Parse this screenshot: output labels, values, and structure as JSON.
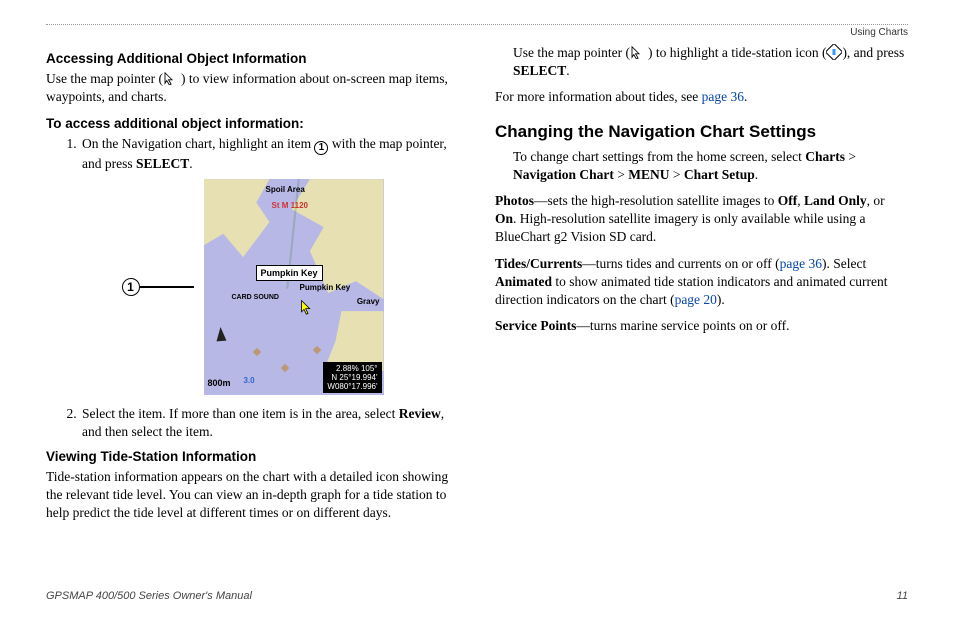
{
  "header": {
    "section": "Using Charts"
  },
  "left": {
    "h1": "Accessing Additional Object Information",
    "p1a": "Use the map pointer (",
    "p1b": ") to view information about on-screen map items, waypoints, and charts.",
    "h2": "To access additional object information:",
    "li1a": "On the Navigation chart, highlight an item ",
    "li1b": " with the map pointer, and press ",
    "li1c": "SELECT",
    "li1d": ".",
    "callout_num": "1",
    "map": {
      "spoil": "Spoil Area",
      "stm": "St M 1120",
      "pk_box": "Pumpkin Key",
      "pk_lbl": "Pumpkin Key",
      "card": "CARD SOUND",
      "gravy": "Gravy",
      "day": "3.0",
      "scale": "800m",
      "f1": "2.88%   105°",
      "f2": "N  25°19.994'",
      "f3": "W080°17.996'"
    },
    "li2a": "Select the item. If more than one item is in the area, select ",
    "li2b": "Review",
    "li2c": ", and then select the item.",
    "h3": "Viewing Tide-Station Information",
    "p3": "Tide-station information appears on the chart with a detailed icon showing the relevant tide level. You can view an in-depth graph for a tide station to help predict the tide level at different times or on different days."
  },
  "right": {
    "p1a": "Use the map pointer (",
    "p1b": ") to highlight a tide-station icon (",
    "p1c": "), and press ",
    "p1d": "SELECT",
    "p1e": ".",
    "p2a": "For more information about tides, see ",
    "p2b": "page 36",
    "p2c": ".",
    "h1": "Changing the Navigation Chart Settings",
    "p3a": "To change chart settings from the home screen, select ",
    "p3b": "Charts",
    "p3c": " > ",
    "p3d": "Navigation Chart",
    "p3e": " > ",
    "p3f": "MENU",
    "p3g": " > ",
    "p3h": "Chart Setup",
    "p3i": ".",
    "p4a": "Photos",
    "p4b": "—sets the high-resolution satellite images to ",
    "p4c": "Off",
    "p4d": ", ",
    "p4e": "Land Only",
    "p4f": ", or ",
    "p4g": "On",
    "p4h": ". High-resolution satellite imagery is only available while using a BlueChart g2 Vision SD card.",
    "p5a": "Tides/Currents",
    "p5b": "—turns tides and currents on or off (",
    "p5c": "page 36",
    "p5d": "). Select ",
    "p5e": "Animated",
    "p5f": " to show animated tide station indicators and animated current direction indicators on the chart (",
    "p5g": "page 20",
    "p5h": ").",
    "p6a": "Service Points",
    "p6b": "—turns marine service points on or off."
  },
  "footer": {
    "left": "GPSMAP 400/500 Series Owner's Manual",
    "right": "11"
  }
}
